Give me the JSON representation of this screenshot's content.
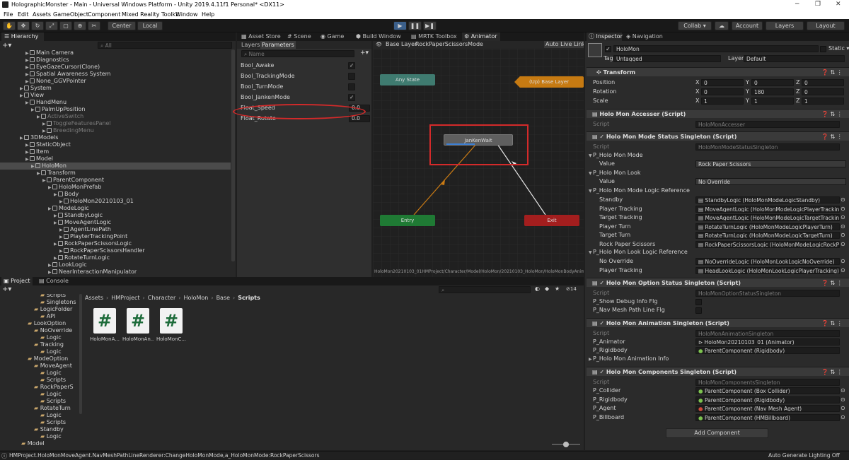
{
  "window": {
    "title": "HolographicMonster - Main - Universal Windows Platform - Unity 2019.4.11f1 Personal* <DX11>",
    "controls": [
      "─",
      "❐",
      "✕"
    ]
  },
  "menu": [
    "File",
    "Edit",
    "Assets",
    "GameObject",
    "Component",
    "Mixed Reality Toolkit",
    "Window",
    "Help"
  ],
  "toolbar": {
    "center_label": "Center",
    "local_label": "Local",
    "collab_label": "Collab ▾",
    "account_label": "Account",
    "layers_label": "Layers",
    "layout_label": "Layout"
  },
  "hierarchy": {
    "tab_label": "Hierarchy",
    "search_placeholder": "All",
    "items": [
      {
        "label": "Main Camera",
        "indent": 4
      },
      {
        "label": "Diagnostics",
        "indent": 4
      },
      {
        "label": "EyeGazeCursor(Clone)",
        "indent": 4
      },
      {
        "label": "Spatial Awareness System",
        "indent": 4
      },
      {
        "label": "None_GGVPointer",
        "indent": 4
      },
      {
        "label": "System",
        "indent": 3
      },
      {
        "label": "View",
        "indent": 3
      },
      {
        "label": "HandMenu",
        "indent": 4
      },
      {
        "label": "PalmUpPosition",
        "indent": 5
      },
      {
        "label": "ActiveSwitch",
        "indent": 6,
        "dim": true
      },
      {
        "label": "ToggleFeaturesPanel",
        "indent": 7,
        "dim": true
      },
      {
        "label": "BreedingMenu",
        "indent": 7,
        "dim": true
      },
      {
        "label": "3DModels",
        "indent": 3
      },
      {
        "label": "StaticObject",
        "indent": 4
      },
      {
        "label": "Item",
        "indent": 4
      },
      {
        "label": "Model",
        "indent": 4
      },
      {
        "label": "HoloMon",
        "indent": 5,
        "selected": true
      },
      {
        "label": "Transform",
        "indent": 6
      },
      {
        "label": "ParentComponent",
        "indent": 7
      },
      {
        "label": "HoloMonPrefab",
        "indent": 8
      },
      {
        "label": "Body",
        "indent": 9
      },
      {
        "label": "HoloMon20210103_01",
        "indent": 10
      },
      {
        "label": "ModeLogic",
        "indent": 8
      },
      {
        "label": "StandbyLogic",
        "indent": 9
      },
      {
        "label": "MoveAgentLogic",
        "indent": 9
      },
      {
        "label": "AgentLinePath",
        "indent": 10
      },
      {
        "label": "PlayterTrackingPoint",
        "indent": 10
      },
      {
        "label": "RockPaperScissorsLogic",
        "indent": 9
      },
      {
        "label": "RockPaperScissorsHandler",
        "indent": 10
      },
      {
        "label": "RotateTurnLogic",
        "indent": 9
      },
      {
        "label": "LookLogic",
        "indent": 8
      },
      {
        "label": "NearInteractionManipulator",
        "indent": 8
      }
    ]
  },
  "center_tabs": [
    "Asset Store",
    "Scene",
    "Game",
    "Build Window",
    "MRTK Toolbox",
    "Animator"
  ],
  "animator": {
    "layers_tab": "Layers",
    "parameters_tab": "Parameters",
    "search_placeholder": "Name",
    "breadcrumb_base": "Base Layer",
    "breadcrumb_state": "RockPaperScissorsMode",
    "auto_live_link": "Auto Live Link",
    "parameters": [
      {
        "name": "Bool_Awake",
        "value": "✓"
      },
      {
        "name": "Bool_TrackingMode",
        "value": ""
      },
      {
        "name": "Bool_TurnMode",
        "value": ""
      },
      {
        "name": "Bool_JankenMode",
        "value": "✓"
      },
      {
        "name": "Float_Speed",
        "value": "0.0"
      },
      {
        "name": "Float_Rotate",
        "value": "0.0"
      }
    ],
    "nodes": {
      "any_state": "Any State",
      "up_base_layer": "(Up) Base Layer",
      "janken_wait": "JanKenWait",
      "entry": "Entry",
      "exit": "Exit"
    },
    "footer_path": "HoloMon20210103_01HMProject/Character/Model/HoloMon/20210103_HoloMon/HoloMonBodyAnim",
    "highlight_color": "#d42a2a"
  },
  "project": {
    "tabs": [
      "Project",
      "Console"
    ],
    "badge_count": "14",
    "tree": [
      {
        "label": "Scripts",
        "indent": 3
      },
      {
        "label": "Singletons",
        "indent": 3
      },
      {
        "label": "LogicFolder",
        "indent": 2
      },
      {
        "label": "API",
        "indent": 3
      },
      {
        "label": "LookOption",
        "indent": 1
      },
      {
        "label": "NoOverride",
        "indent": 2
      },
      {
        "label": "Logic",
        "indent": 3
      },
      {
        "label": "Tracking",
        "indent": 2
      },
      {
        "label": "Logic",
        "indent": 3
      },
      {
        "label": "ModeOption",
        "indent": 1
      },
      {
        "label": "MoveAgent",
        "indent": 2
      },
      {
        "label": "Logic",
        "indent": 3
      },
      {
        "label": "Scripts",
        "indent": 3
      },
      {
        "label": "RockPaperS",
        "indent": 2
      },
      {
        "label": "Logic",
        "indent": 3
      },
      {
        "label": "Scripts",
        "indent": 3
      },
      {
        "label": "RotateTurn",
        "indent": 2
      },
      {
        "label": "Logic",
        "indent": 3
      },
      {
        "label": "Scripts",
        "indent": 3
      },
      {
        "label": "Standby",
        "indent": 2
      },
      {
        "label": "Logic",
        "indent": 3
      },
      {
        "label": "Model",
        "indent": 0
      }
    ],
    "breadcrumb": [
      "Assets",
      "HMProject",
      "Character",
      "HoloMon",
      "Base",
      "Scripts"
    ],
    "files": [
      {
        "glyph": "#",
        "name": "HoloMonA..."
      },
      {
        "glyph": "#",
        "name": "HoloMonAn..."
      },
      {
        "glyph": "#",
        "name": "HoloMonC..."
      }
    ]
  },
  "inspector": {
    "tabs": [
      "Inspector",
      "Navigation"
    ],
    "object_name": "HoloMon",
    "static_label": "Static ▾",
    "tag_label": "Tag",
    "tag_value": "Untagged",
    "layer_label": "Layer",
    "layer_value": "Default",
    "transform": {
      "header": "Transform",
      "position_label": "Position",
      "rotation_label": "Rotation",
      "scale_label": "Scale",
      "position": [
        "0",
        "0",
        "0"
      ],
      "rotation": [
        "0",
        "180",
        "0"
      ],
      "scale": [
        "1",
        "1",
        "1"
      ]
    },
    "accesser": {
      "header": "Holo Mon Accesser (Script)",
      "script_label": "Script",
      "script_value": "HoloMonAccesser"
    },
    "mode_status": {
      "header": "Holo Mon Mode Status Singleton (Script)",
      "script_label": "Script",
      "script_value": "HoloMonModeStatusSingleton",
      "mode_label": "P_Holo Mon Mode",
      "value_label": "Value",
      "mode_value": "Rock Paper Scissors",
      "look_label": "P_Holo Mon Look",
      "look_value": "No Override",
      "mode_logic_label": "P_Holo Mon Mode Logic Reference",
      "mode_logic_rows": [
        {
          "label": "Standby",
          "value": "StandbyLogic (HoloMonModeLogicStandby)"
        },
        {
          "label": "Player Tracking",
          "value": "MoveAgentLogic (HoloMonModeLogicPlayerTracking)"
        },
        {
          "label": "Target Tracking",
          "value": "MoveAgentLogic (HoloMonModeLogicTargetTracking)"
        },
        {
          "label": "Player Turn",
          "value": "RotateTurnLogic (HoloMonModeLogicPlayerTurn)"
        },
        {
          "label": "Target Turn",
          "value": "RotateTurnLogic (HoloMonModeLogicTargetTurn)"
        },
        {
          "label": "Rock Paper Scissors",
          "value": "RockPaperScissorsLogic (HoloMonModeLogicRockPap"
        }
      ],
      "look_logic_label": "P_Holo Mon Look Logic Reference",
      "look_logic_rows": [
        {
          "label": "No Override",
          "value": "NoOverrideLogic (HoloMonLookLogicNoOverride)"
        },
        {
          "label": "Player Tracking",
          "value": "HeadLookLogic (HoloMonLookLogicPlayerTracking)"
        }
      ]
    },
    "option_status": {
      "header": "Holo Mon Option Status Singleton (Script)",
      "script_label": "Script",
      "script_value": "HoloMonOptionStatusSingleton",
      "debug_label": "P_Show Debug Info Flg",
      "navmesh_label": "P_Nav Mesh Path Line Flg"
    },
    "animation": {
      "header": "Holo Mon Animation Singleton (Script)",
      "script_label": "Script",
      "script_value": "HoloMonAnimationSingleton",
      "animator_label": "P_Animator",
      "animator_value": "HoloMon20210103_01 (Animator)",
      "rigidbody_label": "P_Rigidbody",
      "rigidbody_value": "ParentComponent (Rigidbody)",
      "info_label": "P_Holo Mon Animation Info"
    },
    "components": {
      "header": "Holo Mon Components Singleton (Script)",
      "script_label": "Script",
      "script_value": "HoloMonComponentsSingleton",
      "rows": [
        {
          "label": "P_Collider",
          "value": "ParentComponent (Box Collider)"
        },
        {
          "label": "P_Rigidbody",
          "value": "ParentComponent (Rigidbody)"
        },
        {
          "label": "P_Agent",
          "value": "ParentComponent (Nav Mesh Agent)"
        },
        {
          "label": "P_Billboard",
          "value": "ParentComponent (HMBillboard)"
        }
      ]
    },
    "add_component": "Add Component"
  },
  "status": {
    "message": "HMProject.HoloMonMoveAgent.NavMeshPathLineRenderer:ChangeHoloMonMode,a_HoloMonMode:RockPaperScissors",
    "right": "Auto Generate Lighting Off"
  }
}
